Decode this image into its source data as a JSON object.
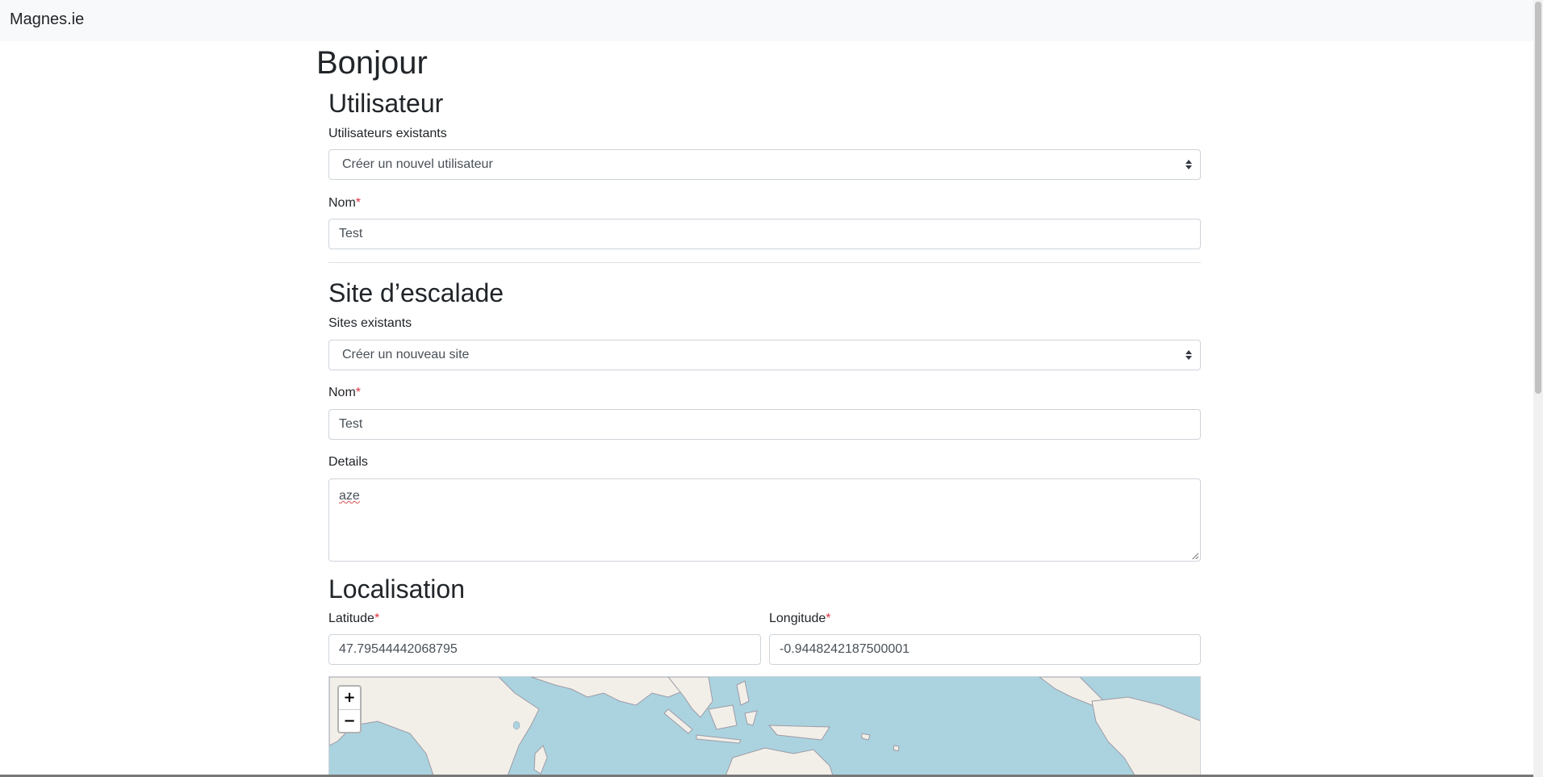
{
  "navbar": {
    "brand": "Magnes.ie"
  },
  "greeting": "Bonjour",
  "user_section": {
    "title": "Utilisateur",
    "existing_label": "Utilisateurs existants",
    "existing_selected": "Créer un nouvel utilisateur",
    "name_label": "Nom",
    "required_mark": "*",
    "name_value": "Test"
  },
  "site_section": {
    "title": "Site d’escalade",
    "existing_label": "Sites existants",
    "existing_selected": "Créer un nouveau site",
    "name_label": "Nom",
    "required_mark": "*",
    "name_value": "Test",
    "details_label": "Details",
    "details_value": "aze"
  },
  "location_section": {
    "title": "Localisation",
    "latitude_label": "Latitude",
    "longitude_label": "Longitude",
    "required_mark": "*",
    "latitude_value": "47.79544442068795",
    "longitude_value": "-0.9448242187500001"
  },
  "map": {
    "zoom_in": "+",
    "zoom_out": "−",
    "colors": {
      "water": "#aad3df",
      "land": "#f2efe9",
      "border": "#9e9aa6"
    }
  }
}
